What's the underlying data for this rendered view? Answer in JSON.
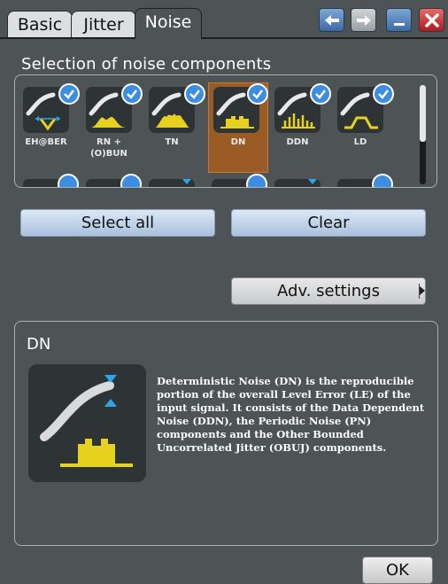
{
  "tabs": [
    {
      "label": "Basic",
      "active": false
    },
    {
      "label": "Jitter",
      "active": false
    },
    {
      "label": "Noise",
      "active": true
    }
  ],
  "window_buttons": [
    {
      "name": "back-icon"
    },
    {
      "name": "forward-icon"
    },
    {
      "name": "minimize-icon"
    },
    {
      "name": "close-icon"
    }
  ],
  "selection": {
    "title": "Selection of noise components",
    "components": [
      {
        "label": "EH@BER",
        "checked": true,
        "selected": false
      },
      {
        "label": "RN +\n(O)BUN",
        "checked": true,
        "selected": false
      },
      {
        "label": "TN",
        "checked": true,
        "selected": false
      },
      {
        "label": "DN",
        "checked": true,
        "selected": true
      },
      {
        "label": "DDN",
        "checked": true,
        "selected": false
      },
      {
        "label": "LD",
        "checked": true,
        "selected": false
      }
    ]
  },
  "buttons": {
    "select_all": "Select all",
    "clear": "Clear",
    "adv_settings": "Adv. settings",
    "ok": "OK"
  },
  "detail": {
    "title": "DN",
    "description": "Deterministic Noise (DN) is the reproducible portion of the overall Level Error (LE) of the input signal. It consists of the Data Dependent Noise (DDN), the Periodic Noise (PN) components and the Other Bounded Uncorrelated Jitter (OBUJ) components."
  },
  "colors": {
    "background": "#4e5356",
    "accent_yellow": "#e6d21e",
    "check_blue": "#3d8ee0",
    "selected_orange": "#9a5b25",
    "marker_blue": "#28a8ea"
  }
}
